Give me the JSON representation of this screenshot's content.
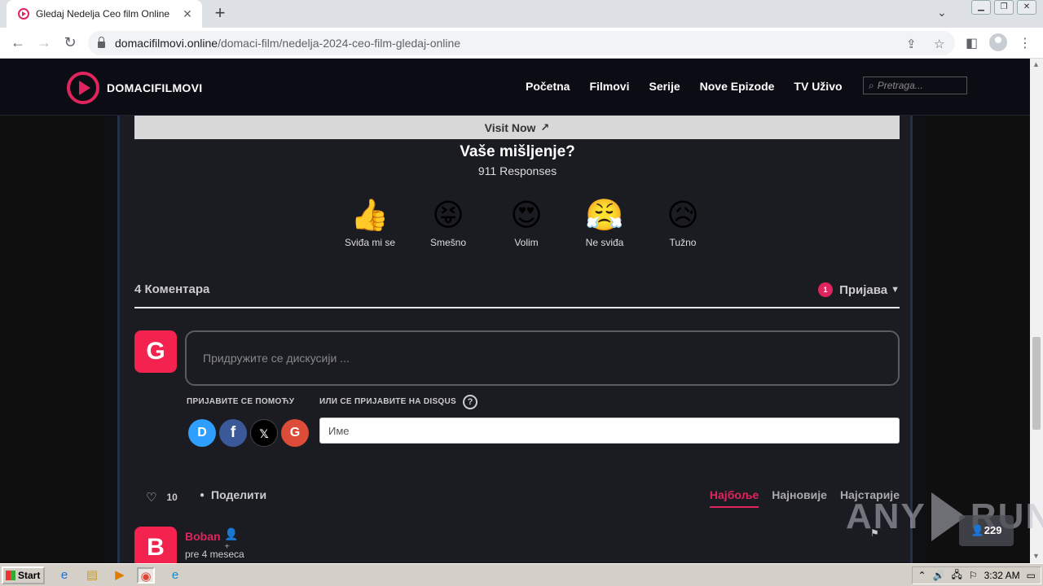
{
  "browser": {
    "tab_title": "Gledaj Nedelja Ceo film Online",
    "tab_close": "✕",
    "new_tab": "+",
    "url_domain": "domacifilmovi.online",
    "url_path": "/domaci-film/nedelja-2024-ceo-film-gledaj-online"
  },
  "site": {
    "brand": "DOMACIFILMOVI",
    "nav": [
      "Početna",
      "Filmovi",
      "Serije",
      "Nove Epizode",
      "TV Uživo"
    ],
    "search_placeholder": "Pretraga..."
  },
  "content": {
    "visit_now": "Visit Now",
    "opinion_title": "Vaše mišljenje?",
    "responses": "911 Responses",
    "reactions": [
      {
        "emoji": "👍",
        "label": "Sviđa mi se"
      },
      {
        "emoji": "😝",
        "label": "Smešno"
      },
      {
        "emoji": "😍",
        "label": "Volim"
      },
      {
        "emoji": "😤",
        "label": "Ne sviđa"
      },
      {
        "emoji": "😥",
        "label": "Tužno"
      }
    ]
  },
  "disqus": {
    "comment_count": "4 Коментара",
    "notif_count": "1",
    "login": "Пријава",
    "avatar_letter": "G",
    "join_placeholder": "Придружите се дискусији ...",
    "sign_with": "ПРИЈАВИТЕ СЕ ПОМОЋУ",
    "or_disqus": "ИЛИ СЕ ПРИЈАВИТЕ НА DISQUS",
    "help": "?",
    "social": [
      "D",
      "f",
      "𝕏",
      "G"
    ],
    "name_placeholder": "Име",
    "likes": "10",
    "share": "Поделити",
    "sort": [
      "Најбоље",
      "Најновије",
      "Најстарије"
    ],
    "comment": {
      "avatar": "B",
      "author": "Boban",
      "time": "pre 4 meseca"
    }
  },
  "overlay": {
    "watermark_left": "ANY",
    "watermark_right": "RUN",
    "viewers": "229"
  },
  "taskbar": {
    "start": "Start",
    "clock": "3:32 AM"
  }
}
